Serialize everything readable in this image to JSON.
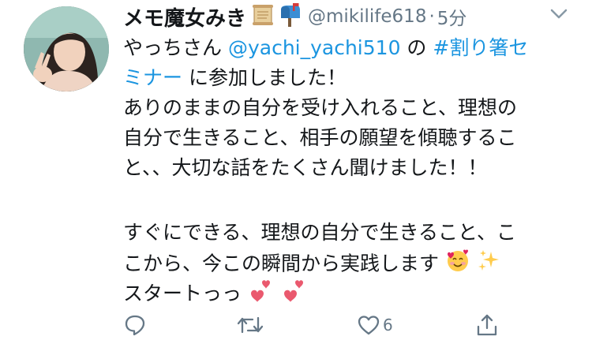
{
  "tweet": {
    "display_name": "メモ魔女みき",
    "handle": "@mikilife618",
    "separator": "·",
    "time": "5分",
    "body": {
      "line1_a": "やっちさん ",
      "mention": "@yachi_yachi510",
      "line1_b": " の ",
      "hashtag_part1": "#割り箸セ",
      "hashtag_part2": "ミナー",
      "line2_rest": " に参加しました！",
      "line3": "ありのままの自分を受け入れること、理想の",
      "line4": "自分で生きること、相手の願望を傾聴するこ",
      "line5": "と、、大切な話をたくさん聞けました！！",
      "line6": "すぐにできる、理想の自分で生きること、こ",
      "line7": "こから、今この瞬間から実践します",
      "line8": "スタートっっ"
    },
    "actions": {
      "like_count": "6"
    }
  },
  "icons": [
    "scroll-icon",
    "mailbox-icon",
    "chevron-down-icon",
    "smiling-face-with-hearts-icon",
    "sparkles-icon",
    "two-hearts-icon",
    "reply-icon",
    "retweet-icon",
    "like-icon",
    "share-icon"
  ],
  "colors": {
    "link": "#1b95e0",
    "secondary": "#657786",
    "text": "#14171a"
  }
}
